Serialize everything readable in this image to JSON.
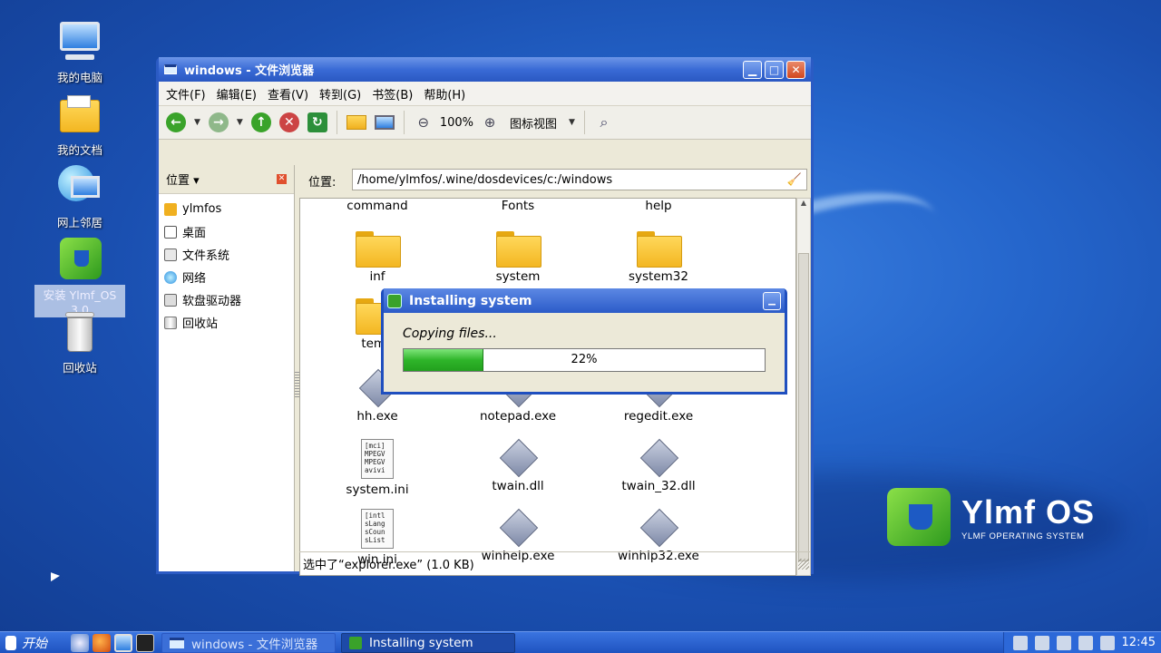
{
  "desktop": {
    "icons": [
      {
        "label": "我的电脑"
      },
      {
        "label": "我的文档"
      },
      {
        "label": "网上邻居"
      },
      {
        "label": "安装 Ylmf_OS 3.0"
      },
      {
        "label": "回收站"
      }
    ],
    "brand": {
      "name": "Ylmf OS",
      "tagline": "YLMF OPERATING SYSTEM"
    }
  },
  "window": {
    "title": "windows - 文件浏览器",
    "menu": [
      "文件(F)",
      "编辑(E)",
      "查看(V)",
      "转到(G)",
      "书签(B)",
      "帮助(H)"
    ],
    "toolbar": {
      "zoom": "100%",
      "view_mode": "图标视图"
    },
    "sidebar": {
      "header": "位置",
      "items": [
        "ylmfos",
        "桌面",
        "文件系统",
        "网络",
        "软盘驱动器",
        "回收站"
      ]
    },
    "location": {
      "label": "位置:",
      "path": "/home/ylmfos/.wine/dosdevices/c:/windows"
    },
    "files": [
      {
        "name": "command",
        "type": "none"
      },
      {
        "name": "Fonts",
        "type": "none"
      },
      {
        "name": "help",
        "type": "none"
      },
      {
        "name": "inf",
        "type": "folder"
      },
      {
        "name": "system",
        "type": "folder"
      },
      {
        "name": "system32",
        "type": "folder"
      },
      {
        "name": "temp",
        "type": "folder"
      },
      {
        "name": "",
        "type": "folder"
      },
      {
        "name": "",
        "type": "exe"
      },
      {
        "name": "hh.exe",
        "type": "exe"
      },
      {
        "name": "notepad.exe",
        "type": "exe"
      },
      {
        "name": "regedit.exe",
        "type": "exe"
      },
      {
        "name": "system.ini",
        "type": "ini",
        "preview": "[mci]\nMPEGV\nMPEGV\navivi"
      },
      {
        "name": "twain.dll",
        "type": "exe"
      },
      {
        "name": "twain_32.dll",
        "type": "exe"
      },
      {
        "name": "win.ini",
        "type": "ini",
        "preview": "[intl\nsLang\nsCoun\nsList"
      },
      {
        "name": "winhelp.exe",
        "type": "exe"
      },
      {
        "name": "winhlp32.exe",
        "type": "exe"
      }
    ],
    "status": "选中了“explorer.exe” (1.0 KB)"
  },
  "dialog": {
    "title": "Installing system",
    "message": "Copying files...",
    "progress": 22,
    "progress_text": "22%"
  },
  "taskbar": {
    "start_label": "开始",
    "tasks": [
      "windows - 文件浏览器",
      "Installing system"
    ],
    "clock": "12:45"
  }
}
